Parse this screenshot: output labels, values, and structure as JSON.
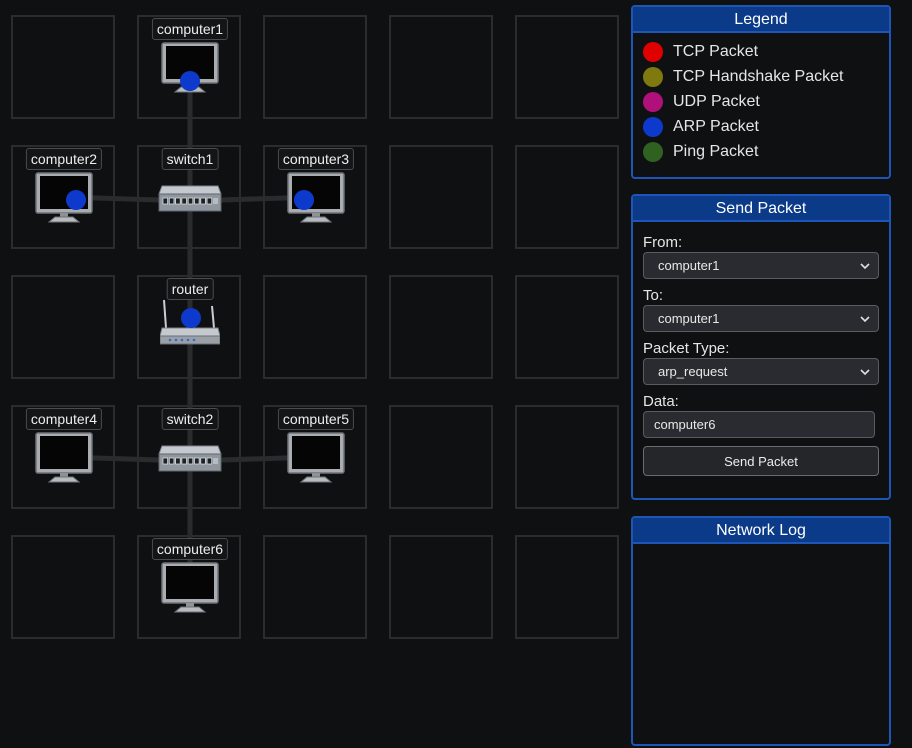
{
  "network": {
    "nodes": [
      {
        "id": "computer1",
        "label": "computer1",
        "type": "computer",
        "col": 1,
        "row": 0,
        "packet": "arp"
      },
      {
        "id": "computer2",
        "label": "computer2",
        "type": "computer",
        "col": 0,
        "row": 1,
        "packet": "arp"
      },
      {
        "id": "switch1",
        "label": "switch1",
        "type": "switch",
        "col": 1,
        "row": 1,
        "packet": null
      },
      {
        "id": "computer3",
        "label": "computer3",
        "type": "computer",
        "col": 2,
        "row": 1,
        "packet": "arp"
      },
      {
        "id": "router",
        "label": "router",
        "type": "router",
        "col": 1,
        "row": 2,
        "packet": "arp"
      },
      {
        "id": "computer4",
        "label": "computer4",
        "type": "computer",
        "col": 0,
        "row": 3,
        "packet": null
      },
      {
        "id": "switch2",
        "label": "switch2",
        "type": "switch",
        "col": 1,
        "row": 3,
        "packet": null
      },
      {
        "id": "computer5",
        "label": "computer5",
        "type": "computer",
        "col": 2,
        "row": 3,
        "packet": null
      },
      {
        "id": "computer6",
        "label": "computer6",
        "type": "computer",
        "col": 1,
        "row": 4,
        "packet": null
      }
    ],
    "links": [
      [
        "computer1",
        "switch1"
      ],
      [
        "computer2",
        "switch1"
      ],
      [
        "switch1",
        "computer3"
      ],
      [
        "switch1",
        "router"
      ],
      [
        "router",
        "switch2"
      ],
      [
        "computer4",
        "switch2"
      ],
      [
        "switch2",
        "computer5"
      ],
      [
        "switch2",
        "computer6"
      ]
    ]
  },
  "legend": {
    "title": "Legend",
    "items": [
      {
        "key": "tcp",
        "label": "TCP Packet",
        "color": "#e00000"
      },
      {
        "key": "handshake",
        "label": "TCP Handshake Packet",
        "color": "#7f7a10"
      },
      {
        "key": "udp",
        "label": "UDP Packet",
        "color": "#b0107a"
      },
      {
        "key": "arp",
        "label": "ARP Packet",
        "color": "#0d3acc"
      },
      {
        "key": "ping",
        "label": "Ping Packet",
        "color": "#2f6220"
      }
    ]
  },
  "send_packet": {
    "title": "Send Packet",
    "from_label": "From:",
    "from_value": "computer1",
    "to_label": "To:",
    "to_value": "computer1",
    "type_label": "Packet Type:",
    "type_value": "arp_request",
    "data_label": "Data:",
    "data_value": "computer6",
    "button_label": "Send Packet"
  },
  "network_log": {
    "title": "Network Log",
    "entries": []
  }
}
